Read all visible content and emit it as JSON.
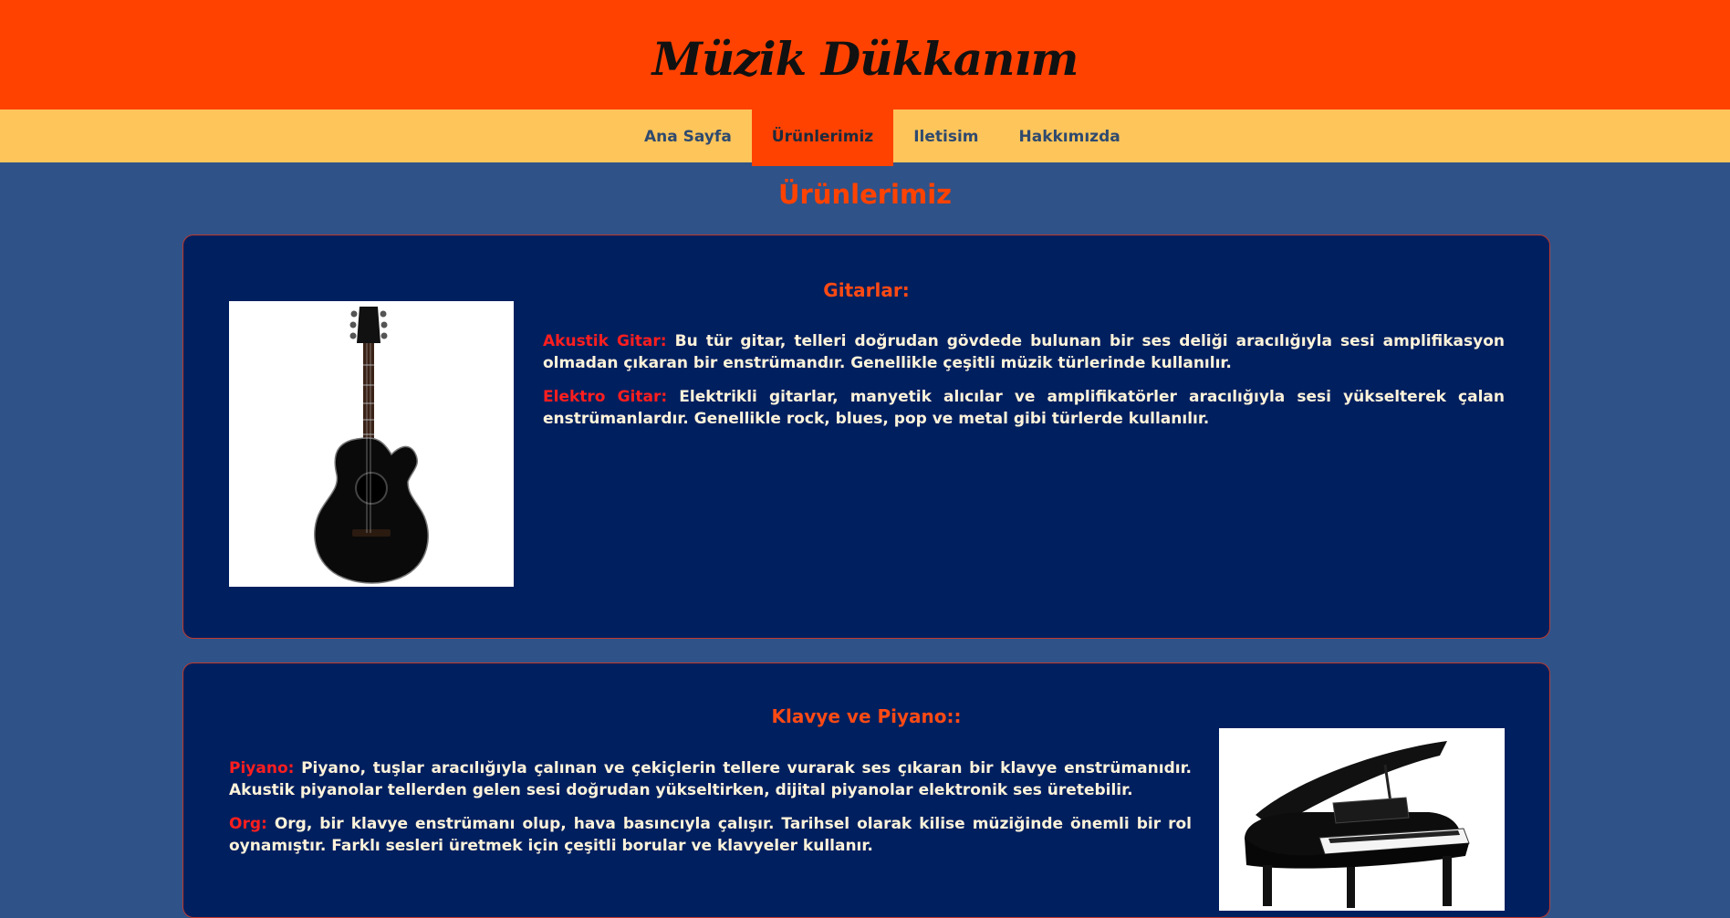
{
  "header": {
    "title": "Müzik Dükkanım"
  },
  "nav": {
    "items": [
      {
        "label": "Ana Sayfa"
      },
      {
        "label": "Ürünlerimiz"
      },
      {
        "label": "Iletisim"
      },
      {
        "label": "Hakkımızda"
      }
    ],
    "active": "Ürünlerimiz"
  },
  "main": {
    "title": "Ürünlerimiz",
    "sections": [
      {
        "heading": "Gitarlar:",
        "image_icon": "acoustic-guitar",
        "items": [
          {
            "term": "Akustik Gitar:",
            "text": "Bu tür gitar, telleri doğrudan gövdede bulunan bir ses deliği aracılığıyla sesi amplifikasyon olmadan çıkaran bir enstrümandır. Genellikle çeşitli müzik türlerinde kullanılır."
          },
          {
            "term": "Elektro Gitar:",
            "text": "Elektrikli gitarlar, manyetik alıcılar ve amplifikatörler aracılığıyla sesi yükselterek çalan enstrümanlardır. Genellikle rock, blues, pop ve metal gibi türlerde kullanılır."
          }
        ]
      },
      {
        "heading": "Klavye ve Piyano::",
        "image_icon": "grand-piano",
        "items": [
          {
            "term": "Piyano:",
            "text": "Piyano, tuşlar aracılığıyla çalınan ve çekiçlerin tellere vurarak ses çıkaran bir klavye enstrümanıdır. Akustik piyanolar tellerden gelen sesi doğrudan yükseltirken, dijital piyanolar elektronik ses üretebilir."
          },
          {
            "term": "Org:",
            "text": "Org, bir klavye enstrümanı olup, hava basıncıyla çalışır. Tarihsel olarak kilise müziğinde önemli bir rol oynamıştır. Farklı sesleri üretmek için çeşitli borular ve klavyeler kullanır."
          }
        ]
      }
    ]
  },
  "colors": {
    "header_bg": "#ff4200",
    "nav_bg": "#fec55b",
    "page_bg": "#2f5289",
    "card_bg": "#001f5f",
    "term": "#ff1e1e",
    "text": "#fff3da"
  }
}
